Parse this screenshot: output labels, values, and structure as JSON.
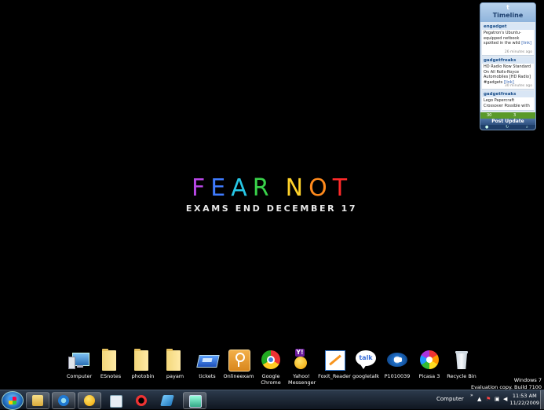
{
  "wallpaper": {
    "title_letters": [
      "F",
      "E",
      "A",
      "R",
      " ",
      "N",
      "O",
      "T"
    ],
    "title_colors": [
      "#b847e6",
      "#3f7bff",
      "#27c7e6",
      "#39d24a",
      "#000000",
      "#ffd22a",
      "#ff8a1c",
      "#ff2a2a"
    ],
    "subtitle": "EXAMS END DECEMBER 17"
  },
  "gadget": {
    "title": "Timeline",
    "tweets": [
      {
        "user": "engadget",
        "text": "Pegatron's Ubuntu-equipped netbook spotted in the wild",
        "link": "[link]",
        "time": "26 minutes ago"
      },
      {
        "user": "gadgetfreaks",
        "text": "HD Radio Now Standard On All Rolls-Royce Automobiles [HD Radio] #gadgets",
        "link": "[link]",
        "time": "30 minutes ago"
      },
      {
        "user": "gadgetfreaks",
        "text": "Lego Papercraft Crossover Possible with",
        "link": "",
        "time": ""
      }
    ],
    "stats_left": "30",
    "stats_right": "3",
    "post_label": "Post Update"
  },
  "desktop_icons": [
    {
      "label": "Computer",
      "icon": "computer-icon"
    },
    {
      "label": "ESnotes",
      "icon": "folder-icon"
    },
    {
      "label": "photobin",
      "icon": "folder-icon"
    },
    {
      "label": "payam",
      "icon": "folder-icon"
    },
    {
      "label": "tickets",
      "icon": "ticket-icon"
    },
    {
      "label": "Onlineexam",
      "icon": "key-icon"
    },
    {
      "label": "Google Chrome",
      "icon": "chrome-icon"
    },
    {
      "label": "Yahoo! Messenger",
      "icon": "yahoo-icon"
    },
    {
      "label": "Foxit_Reader",
      "icon": "pdf-icon"
    },
    {
      "label": "googletalk",
      "icon": "talk-icon"
    },
    {
      "label": "P1010039",
      "icon": "photo-icon"
    },
    {
      "label": "Picasa 3",
      "icon": "picasa-icon"
    },
    {
      "label": "Recycle Bin",
      "icon": "recycle-bin-icon"
    }
  ],
  "watermark": {
    "line1": "Windows 7",
    "line2": "Evaluation copy. Build 7100"
  },
  "taskbar": {
    "pinned": [
      "explorer-icon",
      "ie-icon",
      "yahoo-icon",
      "notepad-icon",
      "rc-icon",
      "paint-icon",
      "monitor-icon"
    ],
    "tray_label": "Computer",
    "time": "11:53 AM",
    "date": "11/22/2009"
  }
}
